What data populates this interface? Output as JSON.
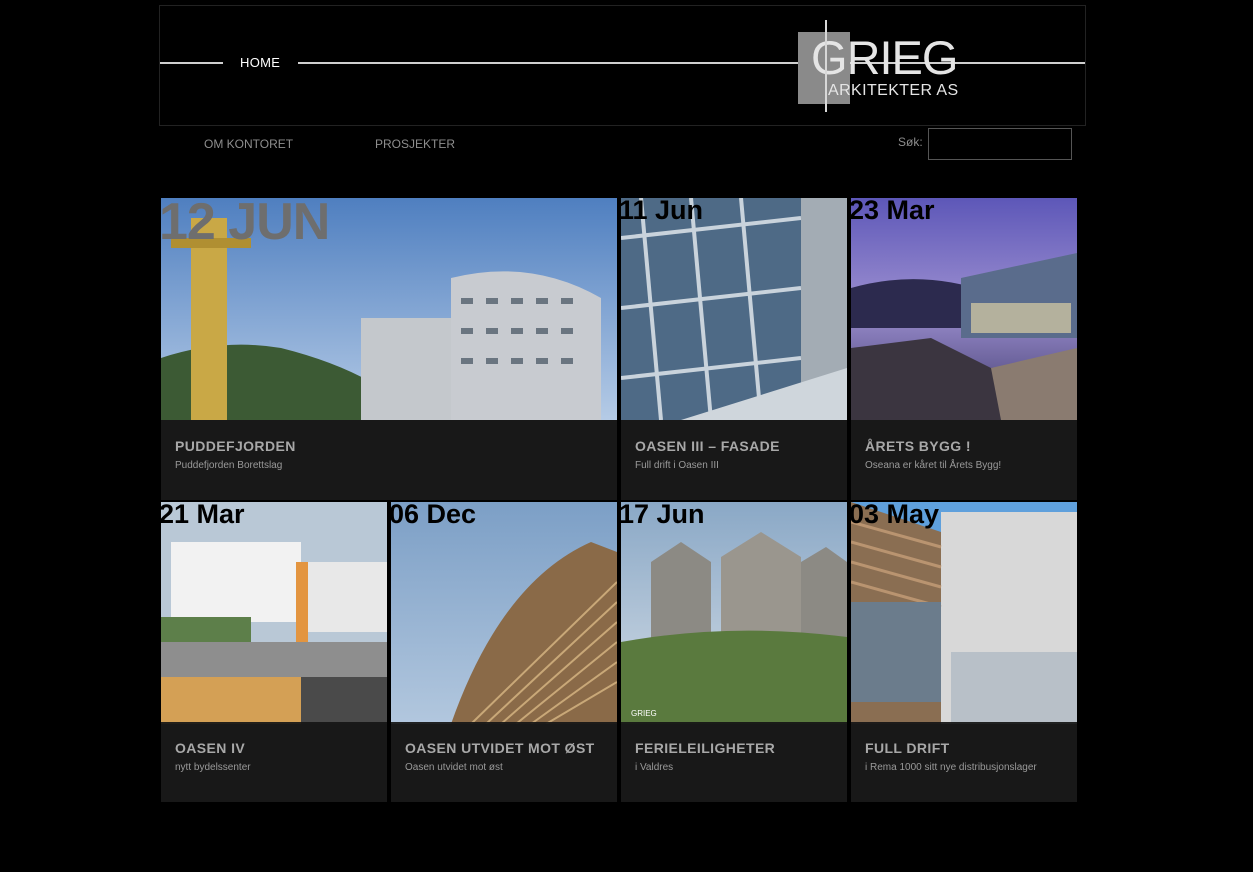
{
  "header": {
    "home_label": "HOME",
    "logo": {
      "word": "GRIEG",
      "sub": "ARKITEKTER AS"
    }
  },
  "nav": {
    "items": [
      "OM KONTORET",
      "PROSJEKTER"
    ]
  },
  "search": {
    "label": "Søk:",
    "placeholder": ""
  },
  "posts": [
    {
      "date": "12 JUN",
      "title": "PUDDEFJORDEN",
      "subtitle": "Puddefjorden Borettslag"
    },
    {
      "date": "11 Jun",
      "title": "OASEN III – FASADE",
      "subtitle": "Full drift i Oasen III"
    },
    {
      "date": "23 Mar",
      "title": "ÅRETS BYGG !",
      "subtitle": "Oseana er kåret til Årets Bygg!"
    },
    {
      "date": "21 Mar",
      "title": "OASEN IV",
      "subtitle": "nytt bydelssenter"
    },
    {
      "date": "06 Dec",
      "title": "OASEN UTVIDET MOT ØST",
      "subtitle": "Oasen utvidet mot øst"
    },
    {
      "date": "17 Jun",
      "title": "FERIELEILIGHETER",
      "subtitle": "i Valdres"
    },
    {
      "date": "03 May",
      "title": "FULL DRIFT",
      "subtitle": "i Rema 1000 sitt nye distribusjonslager"
    }
  ],
  "watermark": "GRIEG"
}
